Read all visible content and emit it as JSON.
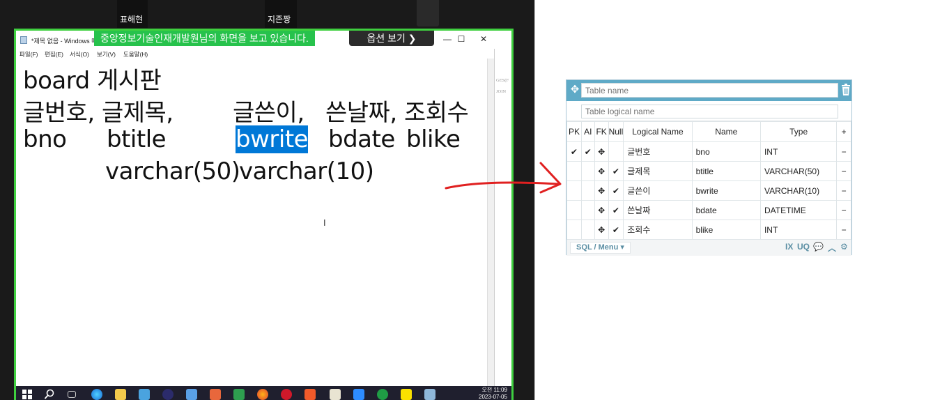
{
  "participants": [
    "표해현",
    "지존짱"
  ],
  "share": {
    "banner_text": "중앙정보기술인재개발원님의 화면을 보고 있습니다.",
    "view_options": "옵션 보기 ❯"
  },
  "notepad": {
    "title": "*제목 없음 - Windows 메모장",
    "menus": [
      "파일(F)",
      "편집(E)",
      "서식(O)",
      "보기(V)",
      "도움말(H)"
    ],
    "lines": {
      "l1": "board 게시판",
      "l2a": "글번호, 글제목,",
      "l2b": "글쓴이,",
      "l2c": "쓴날짜, 조회수",
      "l3a": "bno",
      "l3b": "btitle",
      "l3c": "bwrite",
      "l3d": "bdate",
      "l3e": "blike",
      "l4a": "varchar(50)",
      "l4b": "varchar(10)"
    },
    "side_text": [
      "GES(F",
      "JOIN"
    ]
  },
  "taskbar": {
    "time": "오전 11:09",
    "date": "2023-07-05"
  },
  "erd": {
    "table_name_placeholder": "Table name",
    "logical_name_placeholder": "Table logical name",
    "headers": {
      "pk": "PK",
      "ai": "AI",
      "fk": "FK",
      "null": "Null",
      "logical": "Logical Name",
      "name": "Name",
      "type": "Type"
    },
    "rows": [
      {
        "pk": true,
        "ai": true,
        "null": false,
        "logical": "글번호",
        "name": "bno",
        "type": "INT"
      },
      {
        "pk": false,
        "ai": false,
        "null": true,
        "logical": "글제목",
        "name": "btitle",
        "type": "VARCHAR(50)"
      },
      {
        "pk": false,
        "ai": false,
        "null": true,
        "logical": "글쓴이",
        "name": "bwrite",
        "type": "VARCHAR(10)"
      },
      {
        "pk": false,
        "ai": false,
        "null": true,
        "logical": "쓴날짜",
        "name": "bdate",
        "type": "DATETIME"
      },
      {
        "pk": false,
        "ai": false,
        "null": true,
        "logical": "조회수",
        "name": "blike",
        "type": "INT"
      }
    ],
    "footer": {
      "menu_label": "SQL / Menu ▾",
      "ix": "IX",
      "uq": "UQ"
    },
    "accent": "#5faac7"
  }
}
